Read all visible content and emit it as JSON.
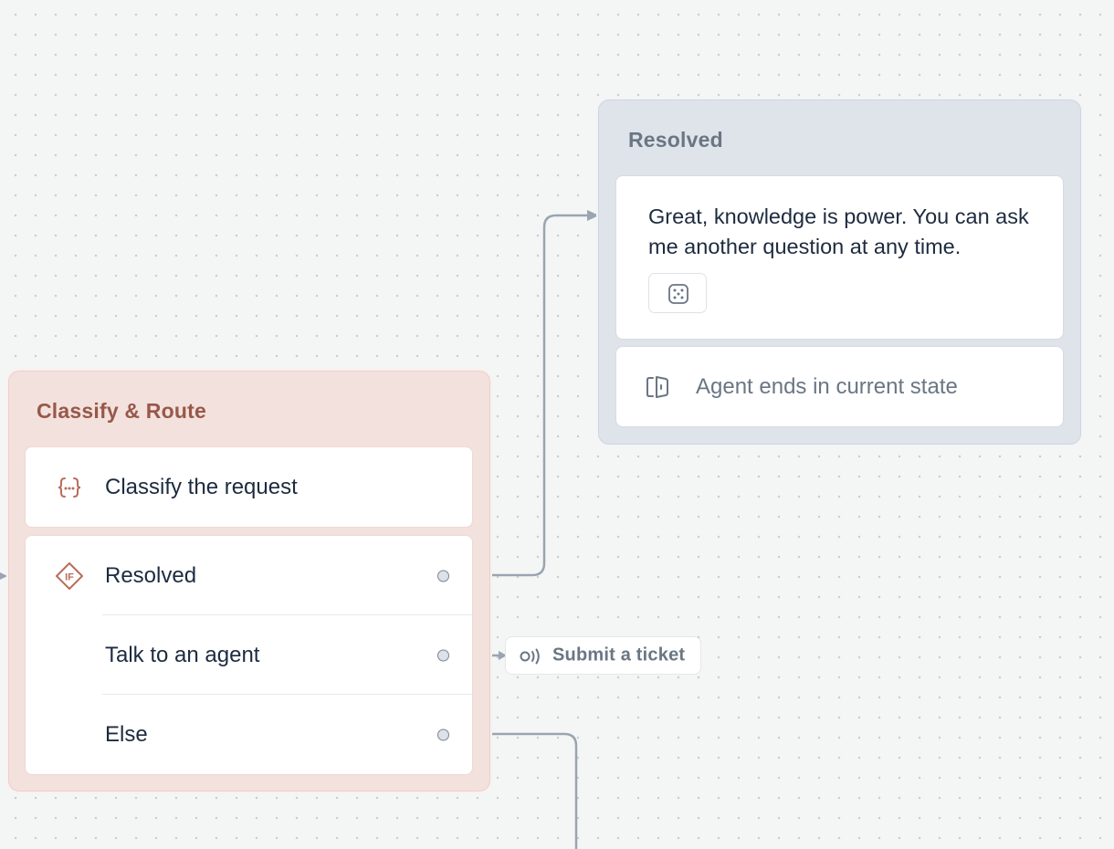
{
  "canvas": {
    "accent_color": "#97584a",
    "connector_color": "#9aa5b1"
  },
  "classify_node": {
    "title": "Classify & Route",
    "step": {
      "label": "Classify the request",
      "icon": "curly-braces-icon"
    },
    "branch_icon": "if-diamond-icon",
    "branches": [
      {
        "label": "Resolved"
      },
      {
        "label": "Talk to an agent"
      },
      {
        "label": "Else"
      }
    ]
  },
  "resolved_node": {
    "title": "Resolved",
    "message": "Great, knowledge is power. You can ask me another question at any time.",
    "message_chip_icon": "dice-icon",
    "end_step": {
      "label": "Agent ends in current state",
      "icon": "exit-door-icon"
    }
  },
  "ticket_pill": {
    "label": "Submit a ticket",
    "icon": "broadcast-icon"
  }
}
